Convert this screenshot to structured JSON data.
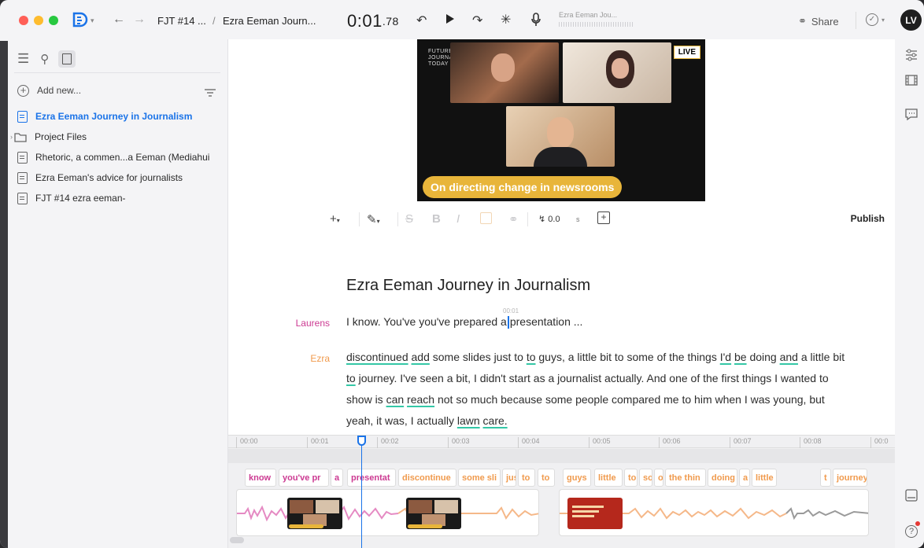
{
  "titlebar": {
    "breadcrumb_project": "FJT #14 ...",
    "breadcrumb_sep": "/",
    "breadcrumb_doc": "Ezra Eeman Journ...",
    "timecode_main": "0:01",
    "timecode_frac": ".78",
    "composition_name": "Ezra Eeman Jou...",
    "share_label": "Share",
    "avatar_initials": "LV"
  },
  "sidebar": {
    "add_new_label": "Add new...",
    "items": [
      {
        "label": "Ezra Eeman Journey in Journalism",
        "type": "doc",
        "active": true
      },
      {
        "label": "Project Files",
        "type": "folder",
        "active": false
      },
      {
        "label": "Rhetoric, a commen...a Eeman (Mediahui",
        "type": "doc",
        "active": false
      },
      {
        "label": "Ezra Eeman's advice for journalists",
        "type": "doc",
        "active": false
      },
      {
        "label": "FJT #14 ezra eeman-",
        "type": "doc",
        "active": false
      }
    ]
  },
  "video": {
    "caption": "On directing change in newsrooms",
    "live_badge": "LIVE",
    "brand_lines": [
      "FUTURE",
      "JOURNALISM",
      "TODAY"
    ]
  },
  "toolbar": {
    "speed_value": "0.0",
    "speed_unit": "s",
    "publish_label": "Publish"
  },
  "document": {
    "title": "Ezra Eeman Journey in Journalism",
    "marker_time": "00:01",
    "paragraphs": [
      {
        "speaker": "Laurens",
        "speaker_color": "#cc3a92",
        "text_before_cursor": "I know. You've you've prepared a",
        "text_after_cursor": "presentation ..."
      },
      {
        "speaker": "Ezra",
        "speaker_color": "#f09a4d"
      }
    ]
  },
  "timeline": {
    "ticks": [
      "00:00",
      "00:01",
      "00:02",
      "00:03",
      "00:04",
      "00:05",
      "00:06",
      "00:07",
      "00:08",
      "00:0"
    ],
    "word_chips": [
      {
        "text": "know",
        "speaker": "m"
      },
      {
        "text": "you've pr",
        "speaker": "m"
      },
      {
        "text": "a",
        "speaker": "m"
      },
      {
        "text": "presentat",
        "speaker": "m"
      },
      {
        "text": "discontinue",
        "speaker": "o"
      },
      {
        "text": "some sli",
        "speaker": "o"
      },
      {
        "text": "jus",
        "speaker": "o"
      },
      {
        "text": "to",
        "speaker": "o"
      },
      {
        "text": "to",
        "speaker": "o"
      },
      {
        "text": "guys",
        "speaker": "o"
      },
      {
        "text": "little",
        "speaker": "o"
      },
      {
        "text": "to",
        "speaker": "o"
      },
      {
        "text": "so",
        "speaker": "o"
      },
      {
        "text": "o",
        "speaker": "o"
      },
      {
        "text": "the thin",
        "speaker": "o"
      },
      {
        "text": "doing",
        "speaker": "o"
      },
      {
        "text": "a",
        "speaker": "o"
      },
      {
        "text": "little",
        "speaker": "o"
      },
      {
        "text": "t",
        "speaker": "o"
      },
      {
        "text": "journey",
        "speaker": "o"
      }
    ]
  }
}
